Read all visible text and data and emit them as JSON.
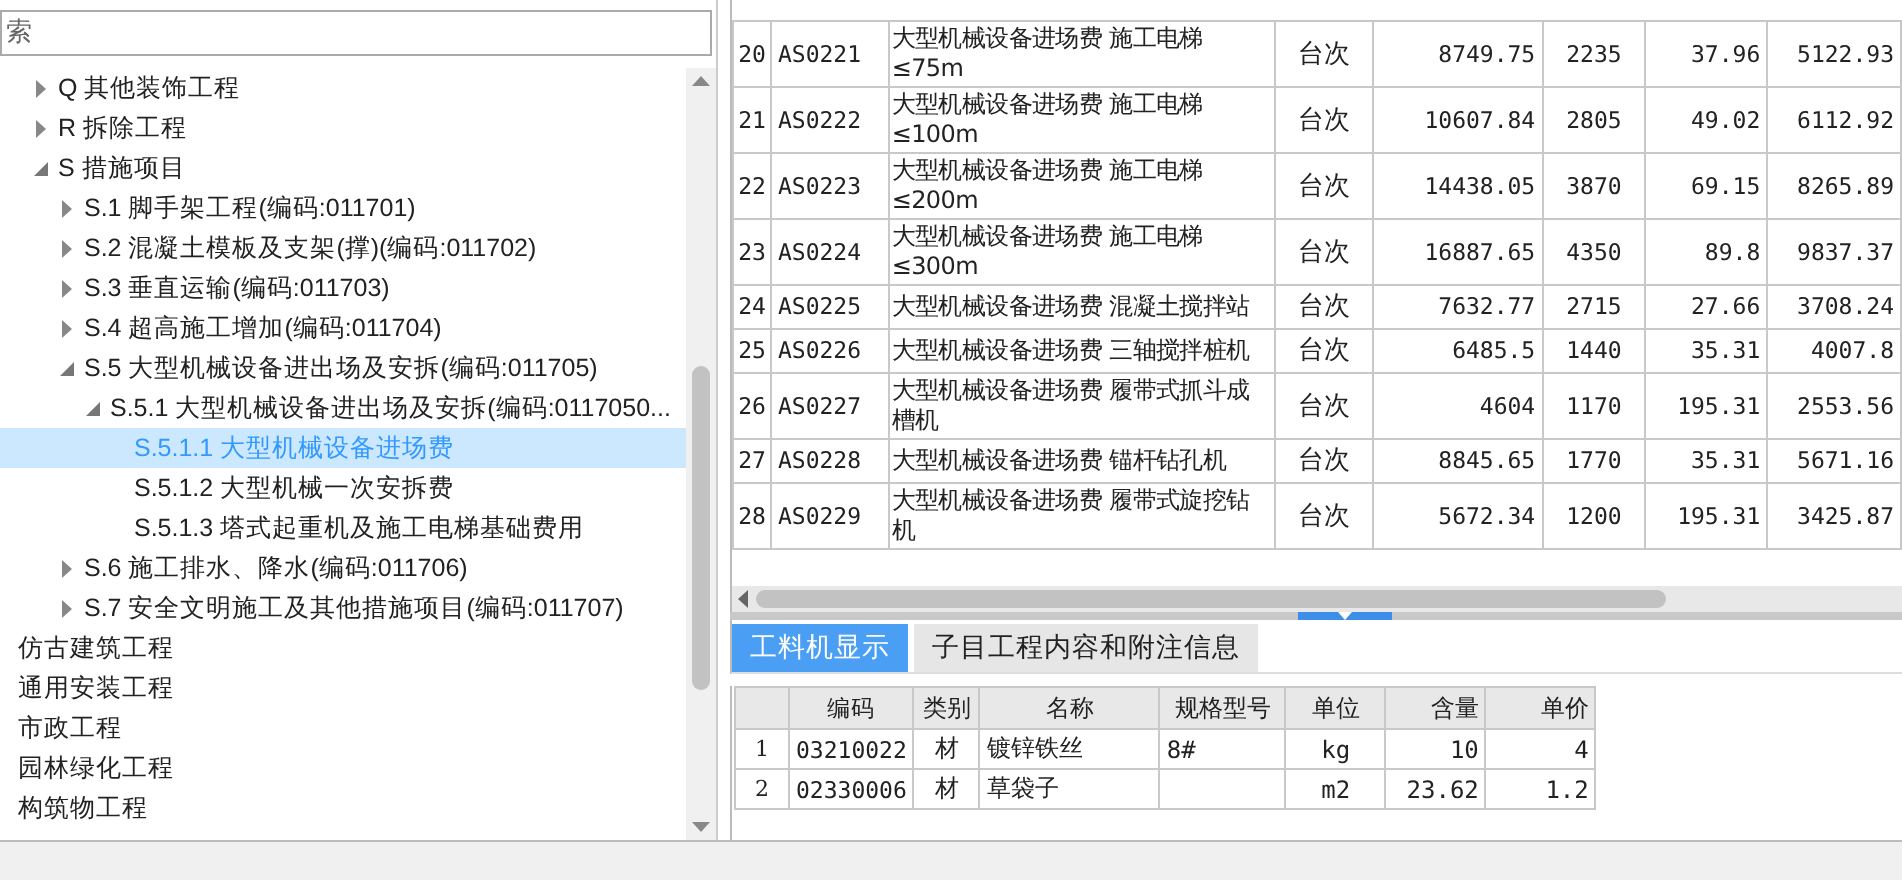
{
  "search": {
    "placeholder": "索"
  },
  "tree": [
    {
      "kind": "node",
      "label": "Q 其他装饰工程",
      "expanded": false,
      "selected": false
    },
    {
      "kind": "node",
      "label": "R 拆除工程",
      "expanded": false,
      "selected": false
    },
    {
      "kind": "node",
      "label": "S 措施项目",
      "expanded": true,
      "selected": false,
      "children": [
        {
          "kind": "node",
          "label": "S.1 脚手架工程(编码:011701)",
          "expanded": false,
          "selected": false
        },
        {
          "kind": "node",
          "label": "S.2 混凝土模板及支架(撑)(编码:011702)",
          "expanded": false,
          "selected": false
        },
        {
          "kind": "node",
          "label": "S.3 垂直运输(编码:011703)",
          "expanded": false,
          "selected": false
        },
        {
          "kind": "node",
          "label": "S.4 超高施工增加(编码:011704)",
          "expanded": false,
          "selected": false
        },
        {
          "kind": "node",
          "label": "S.5 大型机械设备进出场及安拆(编码:011705)",
          "expanded": true,
          "selected": false,
          "children": [
            {
              "kind": "node",
              "label": "S.5.1 大型机械设备进出场及安拆(编码:0117050...",
              "expanded": true,
              "selected": false,
              "children": [
                {
                  "kind": "leaf",
                  "label": "S.5.1.1 大型机械设备进场费",
                  "selected": true
                },
                {
                  "kind": "leaf",
                  "label": "S.5.1.2 大型机械一次安拆费",
                  "selected": false
                },
                {
                  "kind": "leaf",
                  "label": "S.5.1.3 塔式起重机及施工电梯基础费用",
                  "selected": false
                }
              ]
            }
          ]
        },
        {
          "kind": "node",
          "label": "S.6 施工排水、降水(编码:011706)",
          "expanded": false,
          "selected": false
        },
        {
          "kind": "node",
          "label": "S.7 安全文明施工及其他措施项目(编码:011707)",
          "expanded": false,
          "selected": false
        }
      ]
    },
    {
      "kind": "plain",
      "label": "仿古建筑工程",
      "selected": false
    },
    {
      "kind": "plain",
      "label": "通用安装工程",
      "selected": false
    },
    {
      "kind": "plain",
      "label": "市政工程",
      "selected": false
    },
    {
      "kind": "plain",
      "label": "园林绿化工程",
      "selected": false
    },
    {
      "kind": "plain",
      "label": "构筑物工程",
      "selected": false
    }
  ],
  "quota_table": {
    "rows": [
      [
        "20",
        "AS0221",
        "大型机械设备进场费 施工电梯≤75m",
        "台次",
        "8749.75",
        "2235",
        "37.96",
        "5122.93"
      ],
      [
        "21",
        "AS0222",
        "大型机械设备进场费 施工电梯≤100m",
        "台次",
        "10607.84",
        "2805",
        "49.02",
        "6112.92"
      ],
      [
        "22",
        "AS0223",
        "大型机械设备进场费 施工电梯≤200m",
        "台次",
        "14438.05",
        "3870",
        "69.15",
        "8265.89"
      ],
      [
        "23",
        "AS0224",
        "大型机械设备进场费 施工电梯≤300m",
        "台次",
        "16887.65",
        "4350",
        "89.8",
        "9837.37"
      ],
      [
        "24",
        "AS0225",
        "大型机械设备进场费 混凝土搅拌站",
        "台次",
        "7632.77",
        "2715",
        "27.66",
        "3708.24"
      ],
      [
        "25",
        "AS0226",
        "大型机械设备进场费 三轴搅拌桩机",
        "台次",
        "6485.5",
        "1440",
        "35.31",
        "4007.8"
      ],
      [
        "26",
        "AS0227",
        "大型机械设备进场费 履带式抓斗成槽机",
        "台次",
        "4604",
        "1170",
        "195.31",
        "2553.56"
      ],
      [
        "27",
        "AS0228",
        "大型机械设备进场费 锚杆钻孔机",
        "台次",
        "8845.65",
        "1770",
        "35.31",
        "5671.16"
      ],
      [
        "28",
        "AS0229",
        "大型机械设备进场费 履带式旋挖钻机",
        "台次",
        "5672.34",
        "1200",
        "195.31",
        "3425.87"
      ]
    ]
  },
  "detail_tabs": [
    {
      "label": "工料机显示",
      "selected": true
    },
    {
      "label": "子目工程内容和附注信息",
      "selected": false
    }
  ],
  "resource_table": {
    "columns": [
      "",
      "编码",
      "类别",
      "名称",
      "规格型号",
      "单位",
      "含量",
      "单价"
    ],
    "rows": [
      [
        "1",
        "03210022",
        "材",
        "镀锌铁丝",
        "8#",
        "kg",
        "10",
        "4"
      ],
      [
        "2",
        "02330006",
        "材",
        "草袋子",
        "",
        "m2",
        "23.62",
        "1.2"
      ]
    ]
  }
}
